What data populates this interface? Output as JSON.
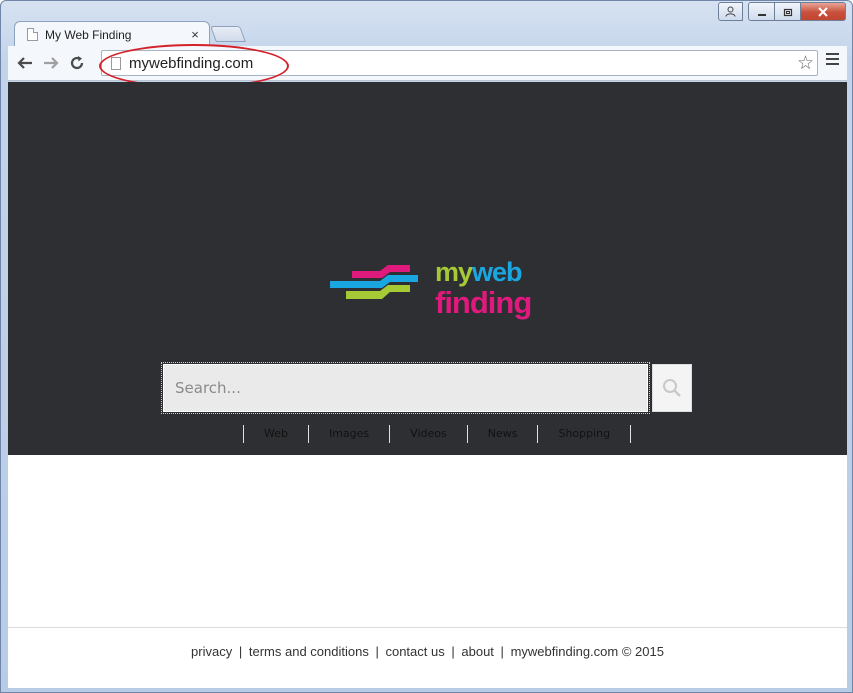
{
  "tab": {
    "title": "My Web Finding",
    "close": "×"
  },
  "omnibox": {
    "url": "mywebfinding.com",
    "star": "☆"
  },
  "window_controls": {
    "user": "👤",
    "minimize": "–",
    "maximize": "▭",
    "close": "✕"
  },
  "nav": {
    "back": "←",
    "forward": "→",
    "reload": "↻"
  },
  "logo": {
    "line1_part1": "my",
    "line1_part2": "web",
    "line2": "finding"
  },
  "search": {
    "placeholder": "Search..."
  },
  "search_tabs": [
    "Web",
    "Images",
    "Videos",
    "News",
    "Shopping"
  ],
  "footer": {
    "links": [
      "privacy",
      "terms and conditions",
      "contact us",
      "about"
    ],
    "copyright": "mywebfinding.com © 2015",
    "separator": "|"
  },
  "colors": {
    "hero_bg": "#2d2f33",
    "logo_green": "#a6c936",
    "logo_blue": "#1aa6e1",
    "logo_pink": "#e0197d",
    "highlight_red": "#d3222a"
  }
}
